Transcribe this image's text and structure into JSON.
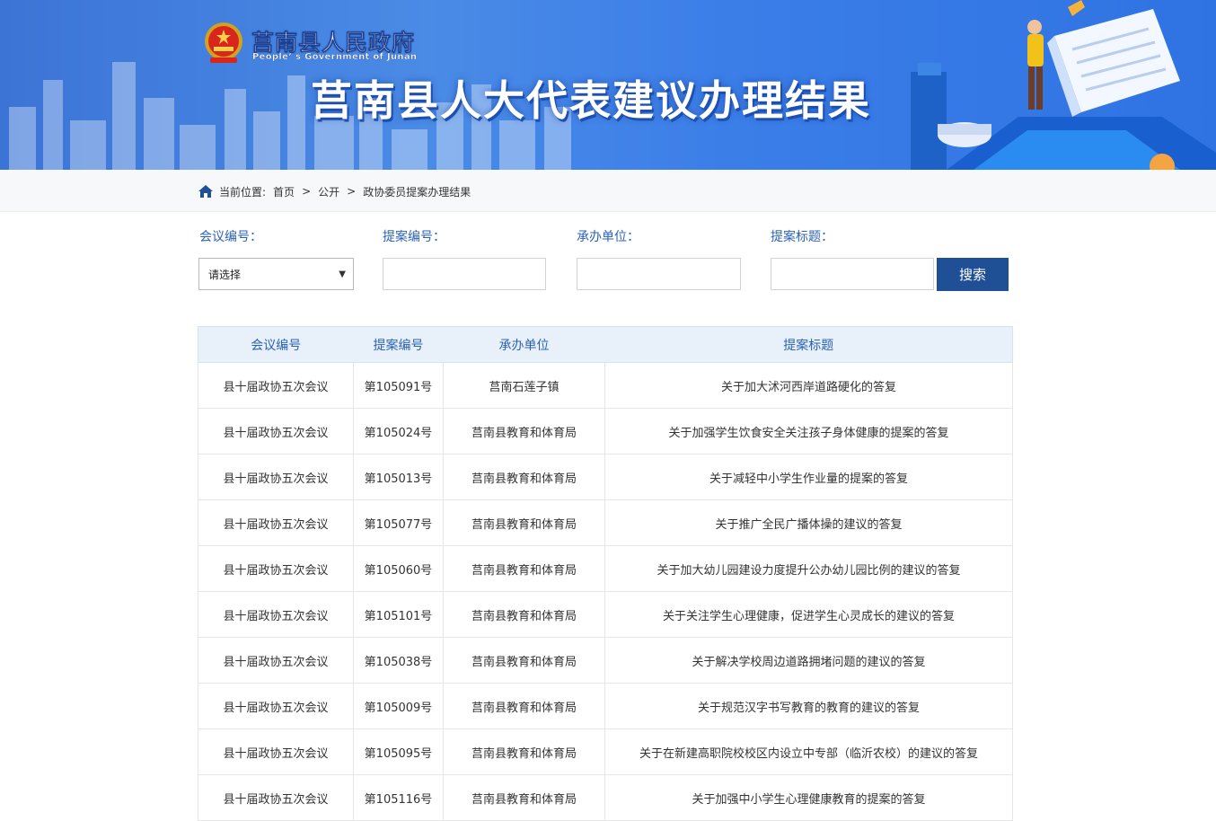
{
  "banner": {
    "gov_name_cn": "莒南县人民政府",
    "gov_name_en": "People’ s Government of Junan",
    "title": "莒南县人大代表建议办理结果"
  },
  "breadcrumb": {
    "prefix": "当前位置:",
    "items": [
      "首页",
      "公开",
      "政协委员提案办理结果"
    ],
    "separator": ">"
  },
  "search": {
    "meeting_label": "会议编号：",
    "meeting_value": "请选择",
    "proposal_label": "提案编号：",
    "unit_label": "承办单位：",
    "title_label": "提案标题：",
    "button_label": "搜索"
  },
  "table": {
    "headers": [
      "会议编号",
      "提案编号",
      "承办单位",
      "提案标题"
    ],
    "rows": [
      [
        "县十届政协五次会议",
        "第105091号",
        "莒南石莲子镇",
        "关于加大沭河西岸道路硬化的答复"
      ],
      [
        "县十届政协五次会议",
        "第105024号",
        "莒南县教育和体育局",
        "关于加强学生饮食安全关注孩子身体健康的提案的答复"
      ],
      [
        "县十届政协五次会议",
        "第105013号",
        "莒南县教育和体育局",
        "关于减轻中小学生作业量的提案的答复"
      ],
      [
        "县十届政协五次会议",
        "第105077号",
        "莒南县教育和体育局",
        "关于推广全民广播体操的建议的答复"
      ],
      [
        "县十届政协五次会议",
        "第105060号",
        "莒南县教育和体育局",
        "关于加大幼儿园建设力度提升公办幼儿园比例的建议的答复"
      ],
      [
        "县十届政协五次会议",
        "第105101号",
        "莒南县教育和体育局",
        "关于关注学生心理健康，促进学生心灵成长的建议的答复"
      ],
      [
        "县十届政协五次会议",
        "第105038号",
        "莒南县教育和体育局",
        "关于解决学校周边道路拥堵问题的建议的答复"
      ],
      [
        "县十届政协五次会议",
        "第105009号",
        "莒南县教育和体育局",
        "关于规范汉字书写教育的教育的建议的答复"
      ],
      [
        "县十届政协五次会议",
        "第105095号",
        "莒南县教育和体育局",
        "关于在新建高职院校校区内设立中专部（临沂农校）的建议的答复"
      ],
      [
        "县十届政协五次会议",
        "第105116号",
        "莒南县教育和体育局",
        "关于加强中小学生心理健康教育的提案的答复"
      ]
    ]
  }
}
